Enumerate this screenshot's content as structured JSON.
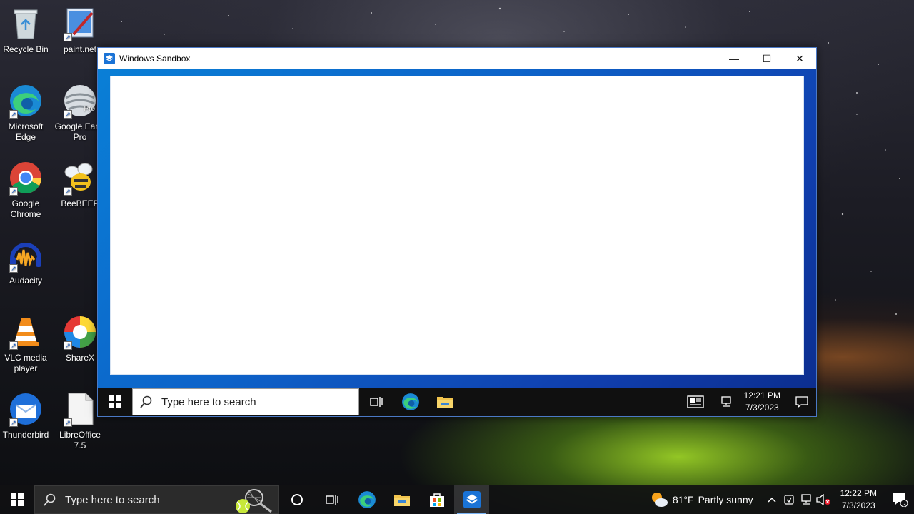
{
  "desktop": {
    "icons": [
      {
        "label": "Recycle Bin",
        "icon": "recycle-bin-icon"
      },
      {
        "label": "paint.net",
        "icon": "paint-net-icon"
      },
      {
        "label": "Microsoft Edge",
        "icon": "edge-icon"
      },
      {
        "label": "Google Earth Pro",
        "icon": "google-earth-icon",
        "badge": "Pro"
      },
      {
        "label": "Google Chrome",
        "icon": "chrome-icon"
      },
      {
        "label": "BeeBEEP",
        "icon": "beebeep-icon"
      },
      {
        "label": "Audacity",
        "icon": "audacity-icon"
      },
      {
        "label": "VLC media player",
        "icon": "vlc-icon"
      },
      {
        "label": "ShareX",
        "icon": "sharex-icon"
      },
      {
        "label": "Thunderbird",
        "icon": "thunderbird-icon"
      },
      {
        "label": "LibreOffice 7.5",
        "icon": "libreoffice-icon"
      }
    ]
  },
  "window": {
    "title": "Windows Sandbox",
    "controls": {
      "minimize": "—",
      "maximize": "☐",
      "close": "✕"
    },
    "inner_taskbar": {
      "search_placeholder": "Type here to search",
      "clock_time": "12:21 PM",
      "clock_date": "7/3/2023"
    }
  },
  "taskbar": {
    "search_placeholder": "Type here to search",
    "weather_temp": "81°F",
    "weather_desc": "Partly sunny",
    "clock_time": "12:22 PM",
    "clock_date": "7/3/2023",
    "notification_count": "1"
  },
  "colors": {
    "sandbox_blue": "#0d63c9",
    "taskbar_bg": "#101012",
    "accent": "#7ab4f5"
  }
}
